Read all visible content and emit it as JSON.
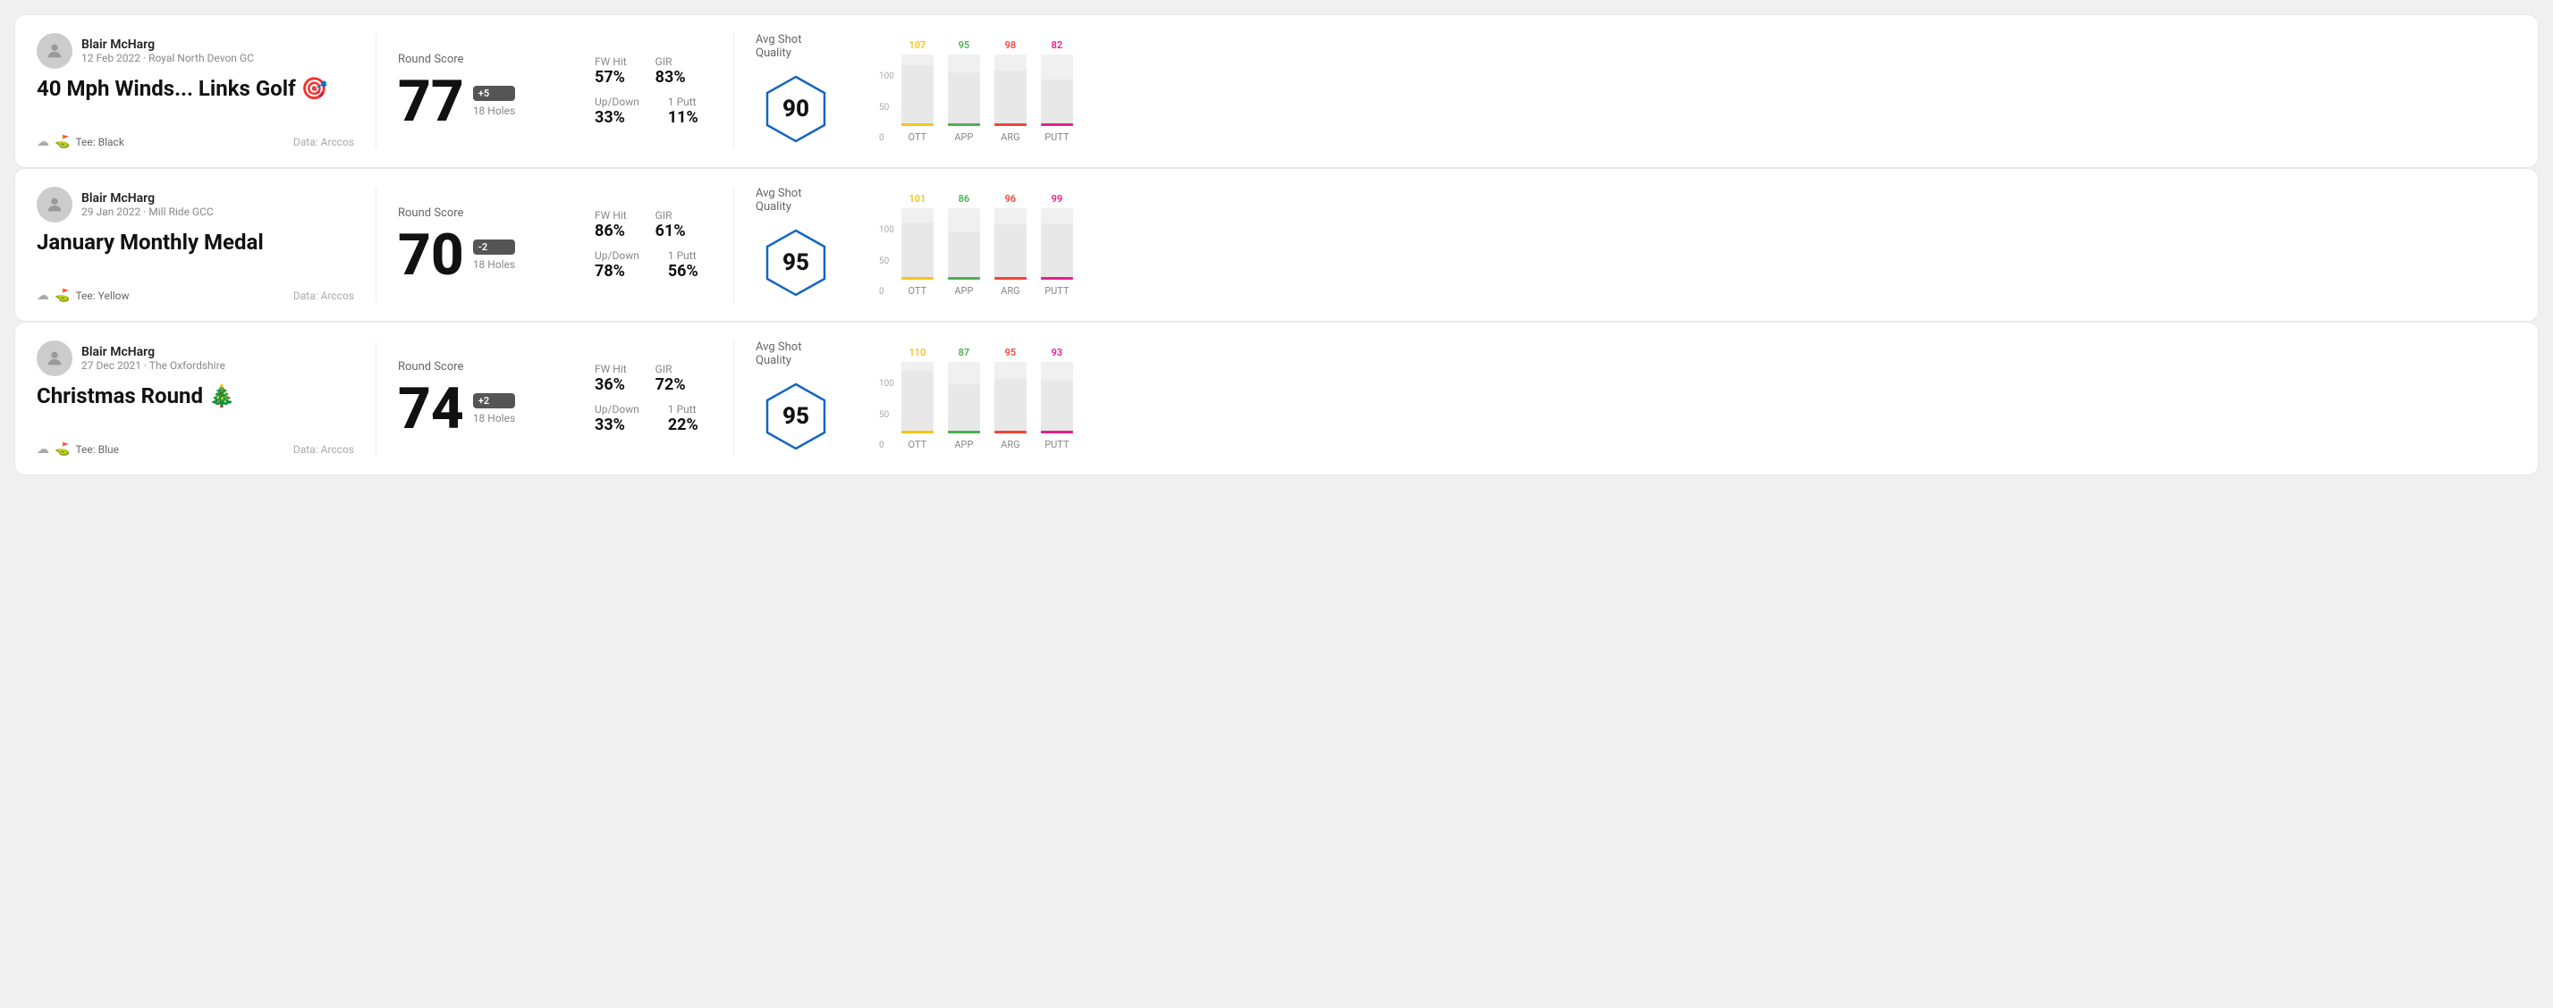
{
  "rounds": [
    {
      "id": "round1",
      "player": "Blair McHarg",
      "date": "12 Feb 2022",
      "course": "Royal North Devon GC",
      "title": "40 Mph Winds... Links Golf 🎯",
      "tee": "Black",
      "dataSource": "Data: Arccos",
      "roundScoreLabel": "Round Score",
      "score": "77",
      "scoreDiff": "+5",
      "holes": "18 Holes",
      "fwHitLabel": "FW Hit",
      "fwHit": "57%",
      "girLabel": "GIR",
      "gir": "83%",
      "upDownLabel": "Up/Down",
      "upDown": "33%",
      "onePuttLabel": "1 Putt",
      "onePutt": "11%",
      "qualityLabel": "Avg Shot Quality",
      "qualityScore": "90",
      "bars": [
        {
          "label": "OTT",
          "value": 107,
          "color": "#f5c518",
          "pct": 85
        },
        {
          "label": "APP",
          "value": 95,
          "color": "#4caf50",
          "pct": 75
        },
        {
          "label": "ARG",
          "value": 98,
          "color": "#f44336",
          "pct": 78
        },
        {
          "label": "PUTT",
          "value": 82,
          "color": "#e91e8c",
          "pct": 65
        }
      ]
    },
    {
      "id": "round2",
      "player": "Blair McHarg",
      "date": "29 Jan 2022",
      "course": "Mill Ride GCC",
      "title": "January Monthly Medal",
      "tee": "Yellow",
      "dataSource": "Data: Arccos",
      "roundScoreLabel": "Round Score",
      "score": "70",
      "scoreDiff": "-2",
      "holes": "18 Holes",
      "fwHitLabel": "FW Hit",
      "fwHit": "86%",
      "girLabel": "GIR",
      "gir": "61%",
      "upDownLabel": "Up/Down",
      "upDown": "78%",
      "onePuttLabel": "1 Putt",
      "onePutt": "56%",
      "qualityLabel": "Avg Shot Quality",
      "qualityScore": "95",
      "bars": [
        {
          "label": "OTT",
          "value": 101,
          "color": "#f5c518",
          "pct": 80
        },
        {
          "label": "APP",
          "value": 86,
          "color": "#4caf50",
          "pct": 68
        },
        {
          "label": "ARG",
          "value": 96,
          "color": "#f44336",
          "pct": 77
        },
        {
          "label": "PUTT",
          "value": 99,
          "color": "#e91e8c",
          "pct": 79
        }
      ]
    },
    {
      "id": "round3",
      "player": "Blair McHarg",
      "date": "27 Dec 2021",
      "course": "The Oxfordshire",
      "title": "Christmas Round 🎄",
      "tee": "Blue",
      "dataSource": "Data: Arccos",
      "roundScoreLabel": "Round Score",
      "score": "74",
      "scoreDiff": "+2",
      "holes": "18 Holes",
      "fwHitLabel": "FW Hit",
      "fwHit": "36%",
      "girLabel": "GIR",
      "gir": "72%",
      "upDownLabel": "Up/Down",
      "upDown": "33%",
      "onePuttLabel": "1 Putt",
      "onePutt": "22%",
      "qualityLabel": "Avg Shot Quality",
      "qualityScore": "95",
      "bars": [
        {
          "label": "OTT",
          "value": 110,
          "color": "#f5c518",
          "pct": 88
        },
        {
          "label": "APP",
          "value": 87,
          "color": "#4caf50",
          "pct": 69
        },
        {
          "label": "ARG",
          "value": 95,
          "color": "#f44336",
          "pct": 76
        },
        {
          "label": "PUTT",
          "value": 93,
          "color": "#e91e8c",
          "pct": 74
        }
      ]
    }
  ],
  "chartMax": 100,
  "chartMid": 50,
  "chartMin": 0
}
